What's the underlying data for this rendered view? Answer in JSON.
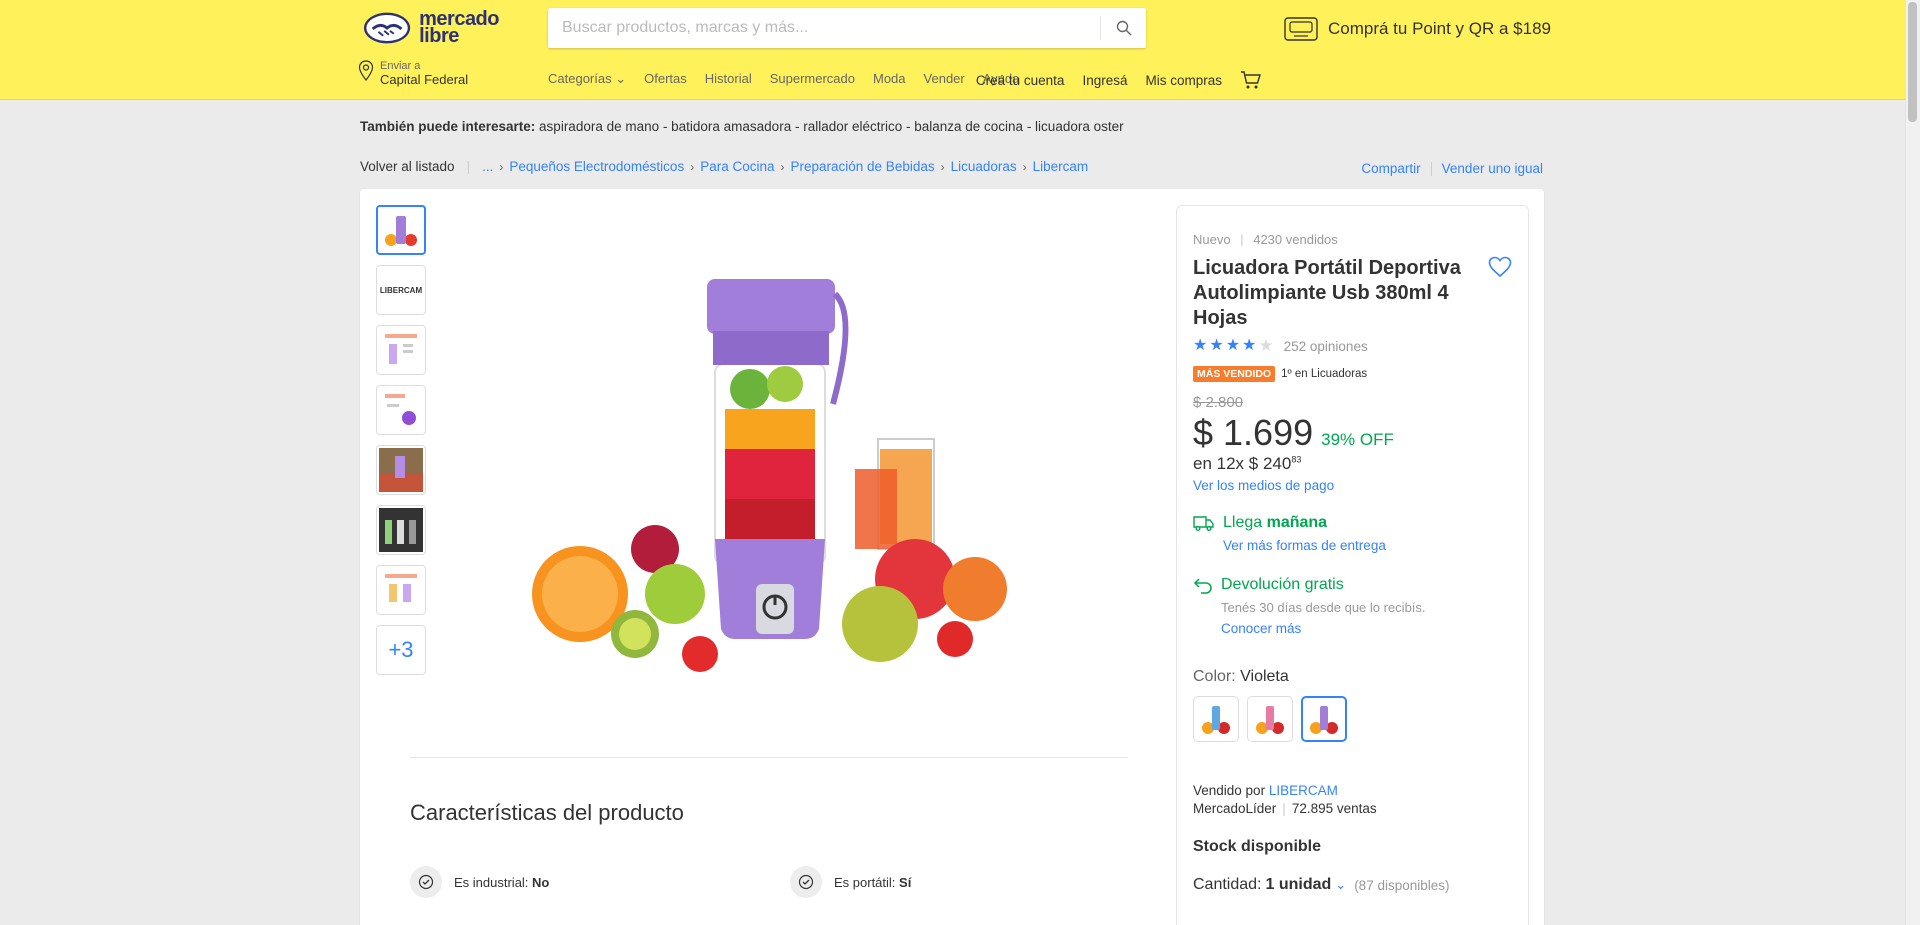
{
  "header": {
    "logo_line1": "mercado",
    "logo_line2": "libre",
    "search_placeholder": "Buscar productos, marcas y más...",
    "promo": "Comprá tu Point y QR a $189",
    "ship_to_small": "Enviar a",
    "ship_to_place": "Capital Federal",
    "nav": [
      "Categorías",
      "Ofertas",
      "Historial",
      "Supermercado",
      "Moda",
      "Vender",
      "Ayuda"
    ],
    "nav_right": [
      "Creá tu cuenta",
      "Ingresá",
      "Mis compras"
    ]
  },
  "interest": {
    "label": "También puede interesarte:",
    "text": " aspiradora de mano - batidora amasadora - rallador eléctrico - balanza de cocina - licuadora oster"
  },
  "breadcrumb": {
    "back": "Volver al listado",
    "ellipsis": "...",
    "items": [
      "Pequeños Electrodomésticos",
      "Para Cocina",
      "Preparación de Bebidas",
      "Licuadoras",
      "Libercam"
    ],
    "share": "Compartir",
    "sell": "Vender uno igual"
  },
  "gallery": {
    "more": "+3",
    "brand_thumb": "LIBERCAM"
  },
  "product": {
    "condition": "Nuevo",
    "sold": "4230 vendidos",
    "title": "Licuadora Portátil Deportiva Autolimpiante Usb 380ml 4 Hojas",
    "rating_value": 4,
    "reviews": "252 opiniones",
    "badge": "MÁS VENDIDO",
    "rank": "1º en Licuadoras",
    "old_price": "$ 2.800",
    "price": "$ 1.699",
    "discount": "39% OFF",
    "install_prefix": "en 12x $ 240",
    "install_cents": "83",
    "payment_link": "Ver los medios de pago",
    "ship_prefix": "Llega ",
    "ship_when": "mañana",
    "ship_link": "Ver más formas de entrega",
    "return_title": "Devolución gratis",
    "return_sub": "Tenés 30 días desde que lo recibís.",
    "return_link": "Conocer más",
    "color_label": "Color: ",
    "color_value": "Violeta",
    "seller_prefix": "Vendido por ",
    "seller_name": "LIBERCAM",
    "seller_level": "MercadoLíder",
    "seller_sales": "72.895 ventas",
    "stock": "Stock disponible",
    "qty_label": "Cantidad: ",
    "qty_value": "1 unidad",
    "qty_avail": "(87 disponibles)"
  },
  "features": {
    "title": "Características del producto",
    "items": [
      {
        "label": "Es industrial: ",
        "value": "No"
      },
      {
        "label": "Es portátil: ",
        "value": "Sí"
      }
    ]
  },
  "colors": {
    "brand_yellow": "#fff159",
    "link_blue": "#3483fa",
    "green": "#00a650",
    "badge_orange": "#f77d2c"
  }
}
